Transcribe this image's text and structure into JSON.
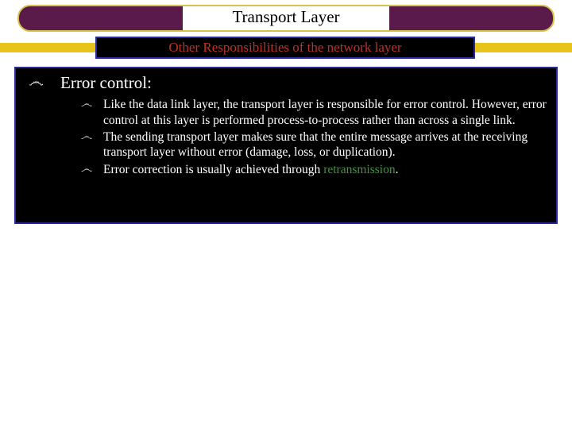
{
  "title": "Transport Layer",
  "subtitle": "Other Responsibilities of the network layer",
  "bullet_glyph": "෴",
  "heading": "Error control:",
  "points": [
    {
      "pre": "Like the data link layer, the transport layer is responsible for error control. However, error control at this layer is performed process-to-process rather than across a single link.",
      "kw": "",
      "post": ""
    },
    {
      "pre": "The sending transport layer makes sure that the entire message arrives at the receiving transport layer without error (damage, loss, or duplication).",
      "kw": "",
      "post": ""
    },
    {
      "pre": "Error correction is usually achieved through ",
      "kw": "retransmission",
      "post": "."
    }
  ]
}
